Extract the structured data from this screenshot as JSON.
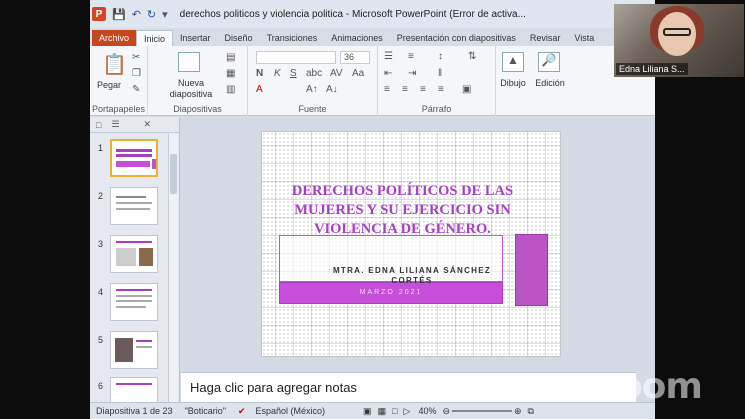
{
  "window": {
    "title": "derechos politicos y violencia politica  -  Microsoft PowerPoint (Error de activa...",
    "app_icon": "P"
  },
  "quick_access": [
    "save-icon",
    "undo-icon",
    "redo-icon",
    "customize-icon"
  ],
  "tabs": [
    "Archivo",
    "Inicio",
    "Insertar",
    "Diseño",
    "Transiciones",
    "Animaciones",
    "Presentación con diapositivas",
    "Revisar",
    "Vista"
  ],
  "active_tab": "Inicio",
  "ribbon": {
    "groups": {
      "clipboard": "Portapapeles",
      "slides": "Diapositivas",
      "font": "Fuente",
      "paragraph": "Párrafo"
    },
    "paste_label": "Pegar",
    "new_slide_label": "Nueva diapositiva",
    "font_size": "36",
    "drawing_label": "Dibujo",
    "editing_label": "Edición"
  },
  "thumbnails": [
    "1",
    "2",
    "3",
    "4",
    "5",
    "6"
  ],
  "selected_slide": 1,
  "slide": {
    "title": "DERECHOS POLÍTICOS DE LAS MUJERES Y SU EJERCICIO SIN VIOLENCIA DE GÉNERO.",
    "author": "MTRA. EDNA LILIANA SÁNCHEZ CORTÉS",
    "date": "MARZO 2021",
    "accent_color": "#a540c2",
    "band_color": "#c64ed8"
  },
  "notes_placeholder": "Haga clic para agregar notas",
  "status": {
    "slide_info": "Diapositiva 1 de 23",
    "theme": "\"Boticario\"",
    "language": "Español (México)",
    "zoom": "40%"
  },
  "video": {
    "participant_name": "Edna Liliana S..."
  },
  "watermark": "zoom"
}
